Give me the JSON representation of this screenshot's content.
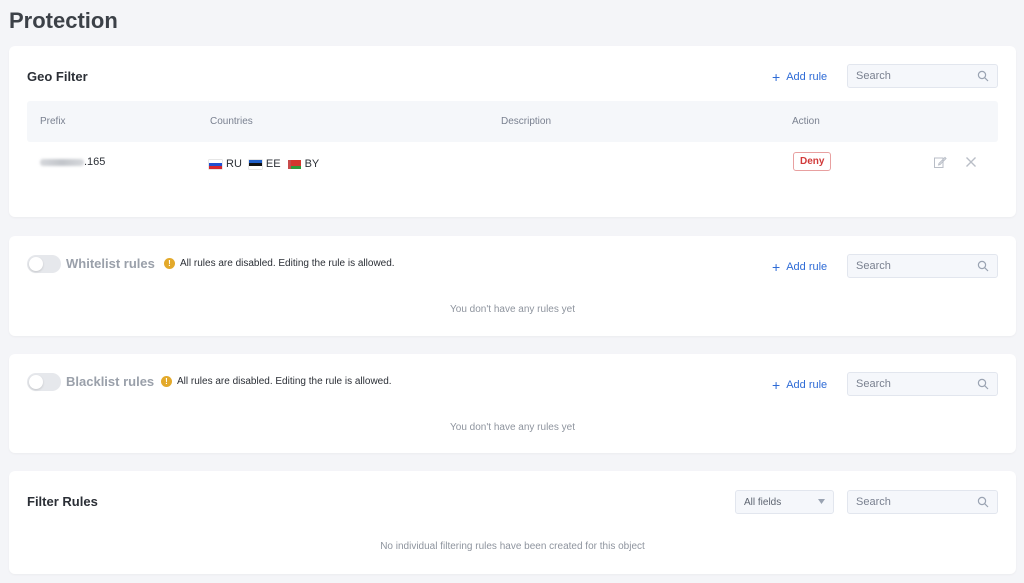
{
  "page": {
    "title": "Protection"
  },
  "geo_filter": {
    "title": "Geo Filter",
    "add_rule_label": "Add rule",
    "search_placeholder": "Search",
    "columns": {
      "prefix": "Prefix",
      "countries": "Countries",
      "description": "Description",
      "action": "Action"
    },
    "rows": [
      {
        "prefix_suffix": ".165",
        "countries": [
          {
            "code": "RU",
            "flag": "flag-ru"
          },
          {
            "code": "EE",
            "flag": "flag-ee"
          },
          {
            "code": "BY",
            "flag": "flag-by"
          }
        ],
        "description": "",
        "action": "Deny"
      }
    ]
  },
  "whitelist": {
    "title": "Whitelist rules",
    "notice": "All rules are disabled. Editing the rule is allowed.",
    "add_rule_label": "Add rule",
    "search_placeholder": "Search",
    "empty_message": "You don't have any rules yet",
    "enabled": false
  },
  "blacklist": {
    "title": "Blacklist rules",
    "notice": "All rules are disabled. Editing the rule is allowed.",
    "add_rule_label": "Add rule",
    "search_placeholder": "Search",
    "empty_message": "You don't have any rules yet",
    "enabled": false
  },
  "filter_rules": {
    "title": "Filter Rules",
    "field_select_value": "All fields",
    "search_placeholder": "Search",
    "empty_message": "No individual filtering rules have been created for this object"
  },
  "colors": {
    "accent": "#2e6bd6",
    "deny": "#d13a3a",
    "warning": "#e3a92a",
    "background": "#f4f5f8"
  }
}
